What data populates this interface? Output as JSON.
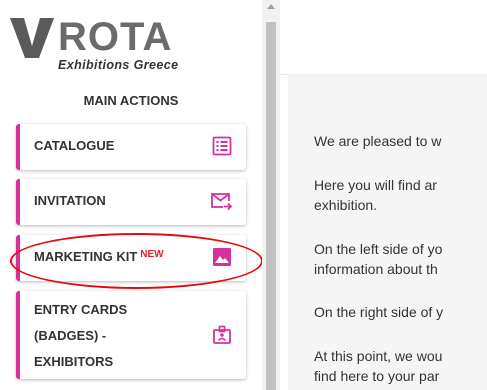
{
  "logo": {
    "name": "ROTA",
    "subtitle": "Exhibitions Greece"
  },
  "sidebar": {
    "section_title": "MAIN ACTIONS",
    "items": [
      {
        "label": "CATALOGUE",
        "icon": "catalogue-list-icon"
      },
      {
        "label": "INVITATION",
        "icon": "mail-send-icon"
      },
      {
        "label": "MARKETING KIT",
        "badge": "NEW",
        "icon": "image-icon",
        "highlighted": true
      },
      {
        "label_lines": [
          "ENTRY CARDS",
          "(BADGES) -",
          "EXHIBITORS"
        ],
        "icon": "badge-icon"
      }
    ]
  },
  "main": {
    "paragraphs": [
      "We are pleased to w",
      "Here you will find ar",
      "exhibition.",
      "On the left side of yo",
      "information about th",
      "On the right side of y",
      "At this point, we wou",
      "find here to your par"
    ]
  },
  "colors": {
    "accent": "#d6309a",
    "annotation": "#e10d0d",
    "new_badge": "#e0202a"
  }
}
